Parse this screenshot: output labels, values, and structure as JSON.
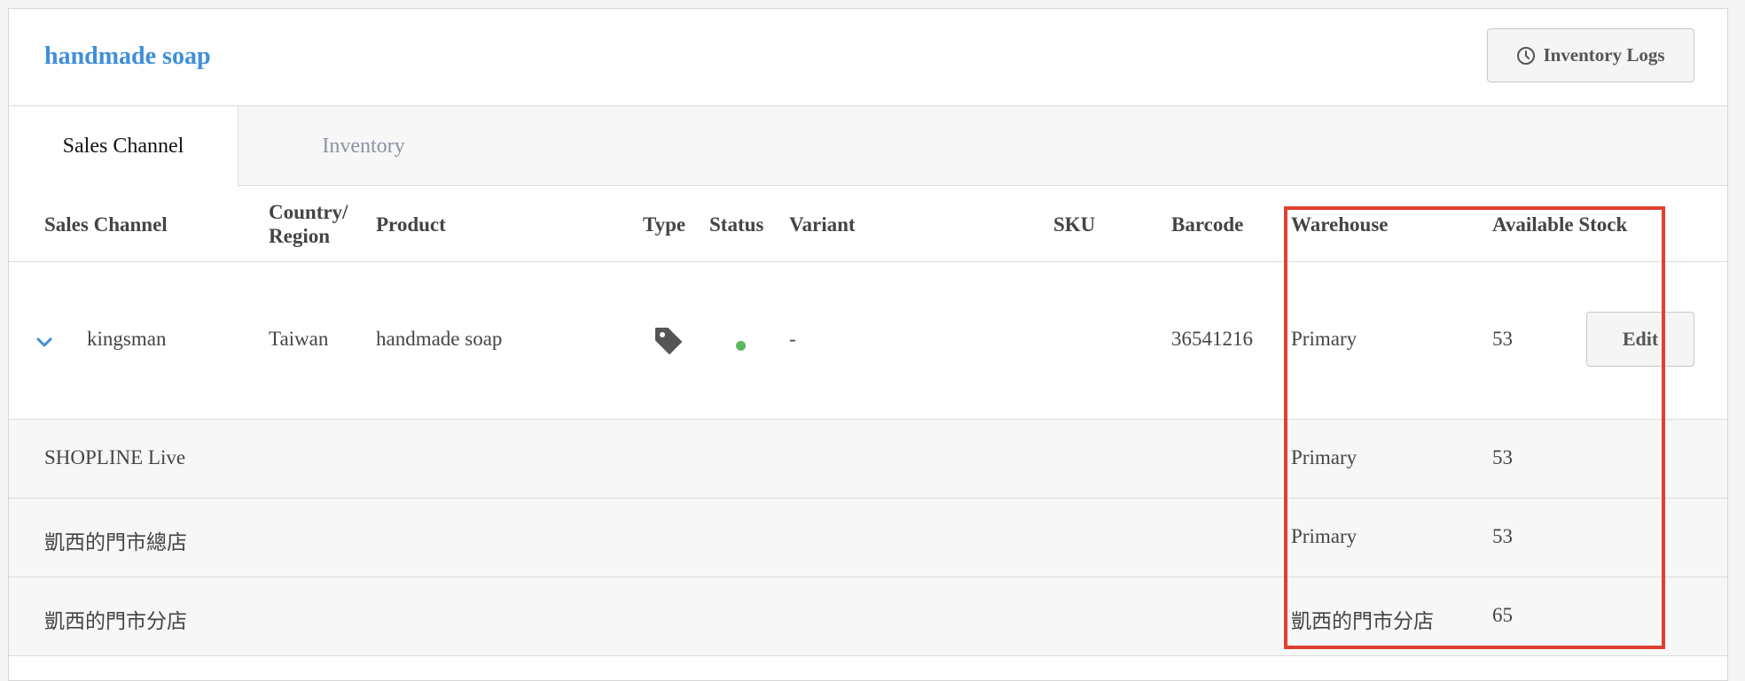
{
  "header": {
    "title": "handmade soap",
    "inventory_logs_label": "Inventory Logs"
  },
  "tabs": [
    {
      "label": "Sales Channel",
      "active": true
    },
    {
      "label": "Inventory",
      "active": false
    }
  ],
  "table": {
    "columns": {
      "sales_channel": "Sales Channel",
      "country_line1": "Country/",
      "country_line2": "Region",
      "product": "Product",
      "type": "Type",
      "status": "Status",
      "variant": "Variant",
      "sku": "SKU",
      "barcode": "Barcode",
      "warehouse": "Warehouse",
      "available_stock": "Available Stock"
    },
    "main_row": {
      "sales_channel": "kingsman",
      "country": "Taiwan",
      "product": "handmade soap",
      "type_icon": "tag-icon",
      "status_color": "#5cb85c",
      "variant": "-",
      "sku": "",
      "barcode": "36541216",
      "warehouse": "Primary",
      "available_stock": "53",
      "edit_label": "Edit"
    },
    "sub_rows": [
      {
        "sales_channel": "SHOPLINE Live",
        "warehouse": "Primary",
        "available_stock": "53"
      },
      {
        "sales_channel": "凱西的門市總店",
        "warehouse": "Primary",
        "available_stock": "53"
      },
      {
        "sales_channel": "凱西的門市分店",
        "warehouse": "凱西的門市分店",
        "available_stock": "65"
      }
    ]
  },
  "colors": {
    "accent": "#3f8fd8",
    "highlight": "#e0402f",
    "status_active": "#5cb85c"
  }
}
